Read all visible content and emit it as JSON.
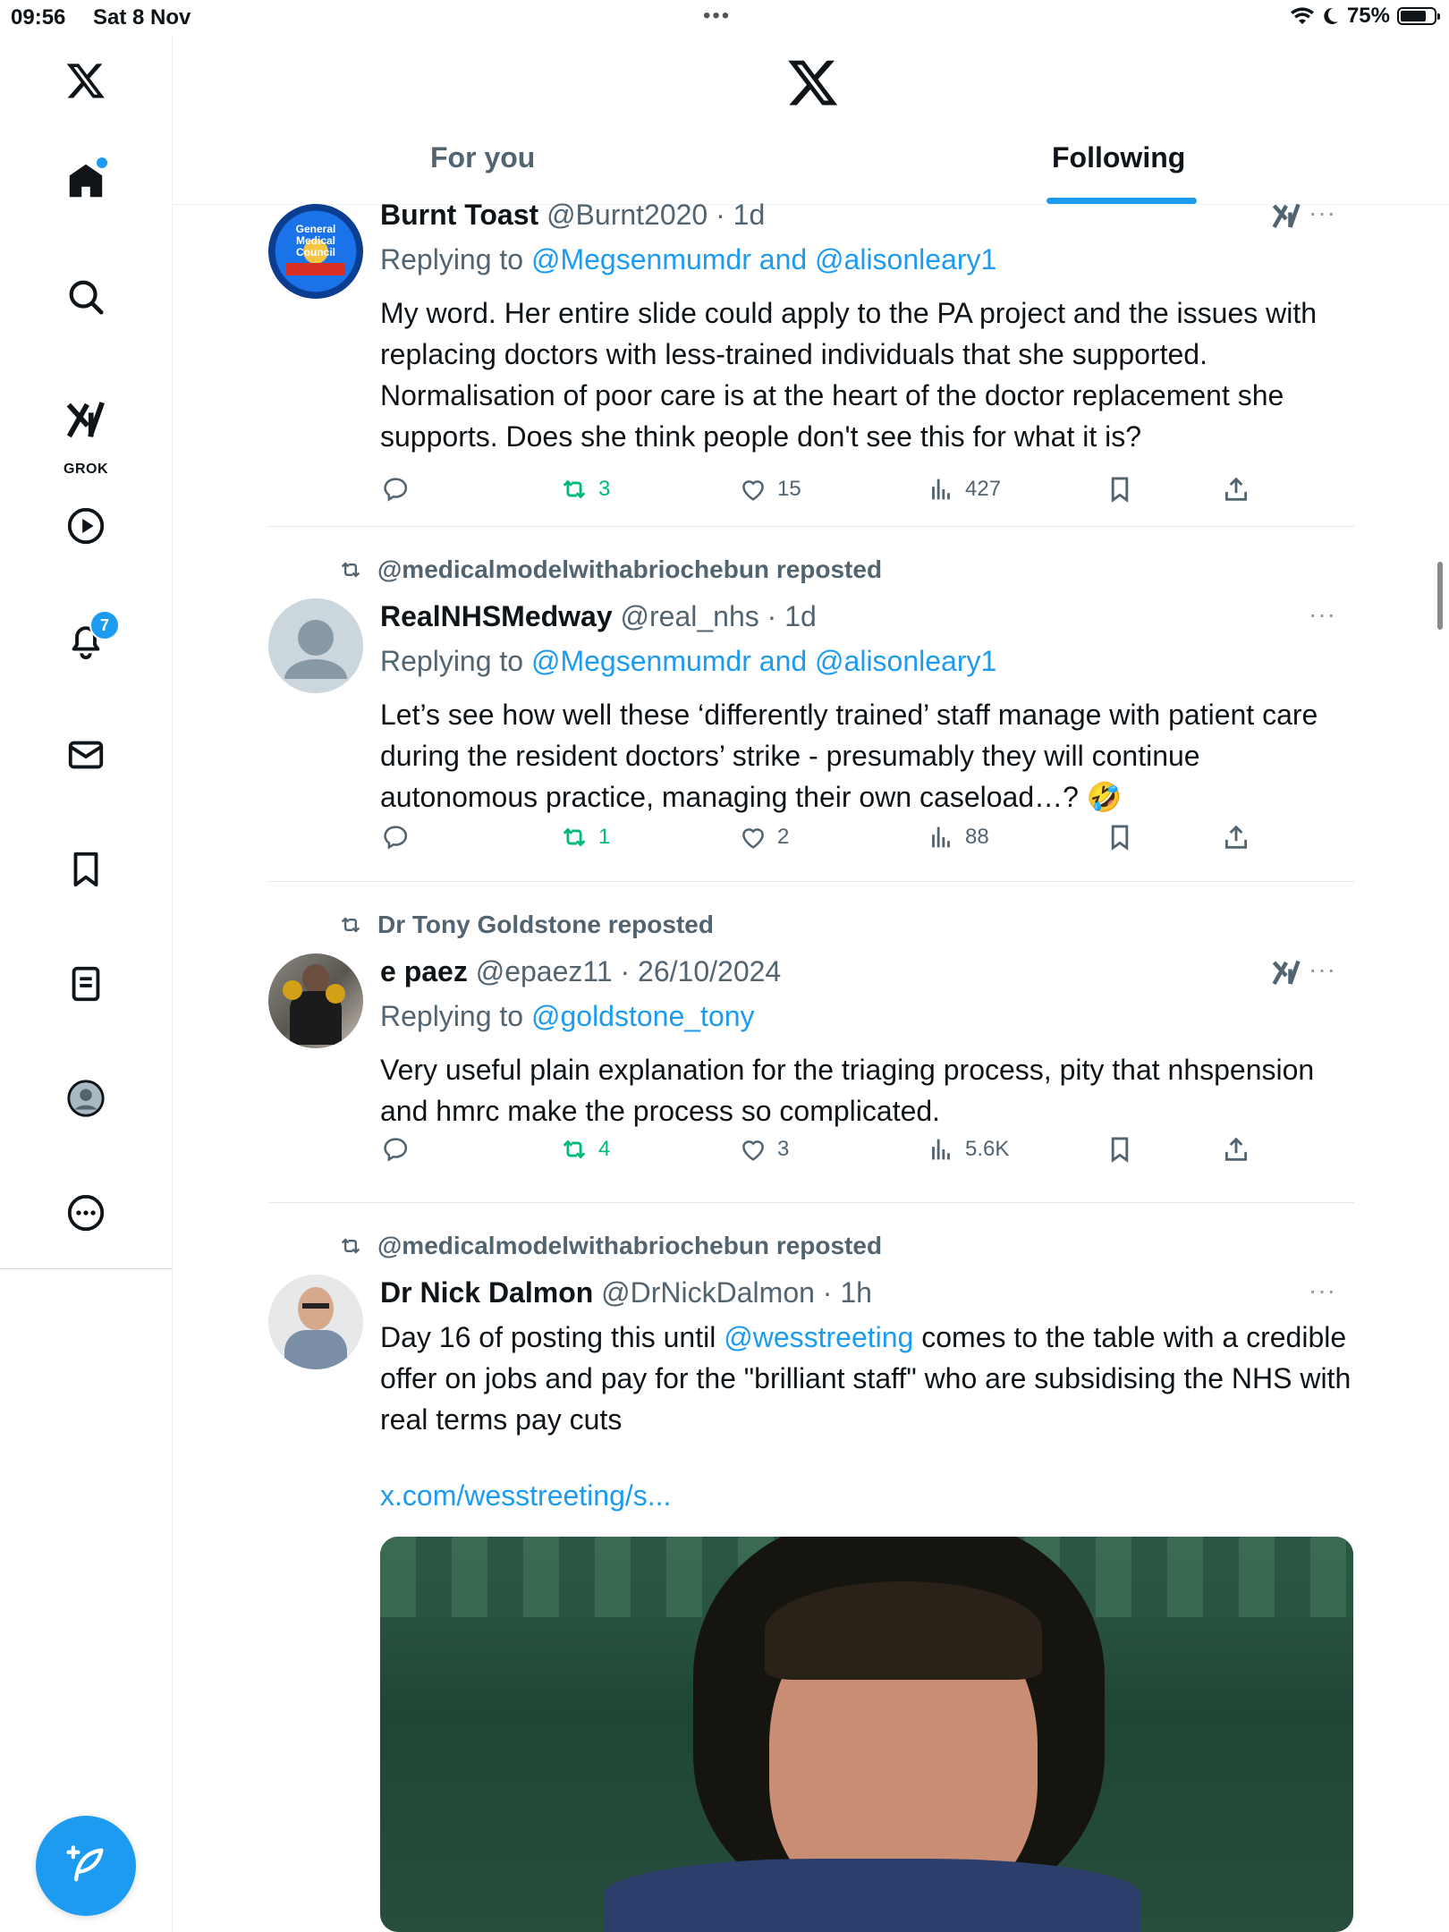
{
  "status_bar": {
    "time": "09:56",
    "date": "Sat 8 Nov",
    "battery": "75%",
    "battery_level": 0.75
  },
  "sidebar": {
    "logo": "x-logo-icon",
    "items": [
      {
        "name": "home",
        "icon": "home-icon",
        "has_dot": true
      },
      {
        "name": "search",
        "icon": "search-icon"
      },
      {
        "name": "grok",
        "icon": "grok-icon",
        "label": "GROK"
      },
      {
        "name": "videos",
        "icon": "play-icon"
      },
      {
        "name": "notifications",
        "icon": "bell-icon",
        "badge": "7"
      },
      {
        "name": "messages",
        "icon": "mail-icon"
      },
      {
        "name": "bookmarks",
        "icon": "bookmark-icon"
      },
      {
        "name": "lists",
        "icon": "list-icon"
      },
      {
        "name": "profile",
        "icon": "profile-icon"
      },
      {
        "name": "more",
        "icon": "more-circle-icon"
      }
    ],
    "compose_icon": "compose-icon"
  },
  "header": {
    "tabs": [
      {
        "label": "For you",
        "active": false
      },
      {
        "label": "Following",
        "active": true
      }
    ]
  },
  "colors": {
    "accent": "#1d9bf0",
    "repost_green": "#00ba7c",
    "muted": "#536471",
    "text": "#0f1419"
  },
  "posts": [
    {
      "repost_by": "",
      "name": "Burnt Toast",
      "handle": "@Burnt2020",
      "time": "· 1d",
      "replying_prefix": "Replying to ",
      "replying_to": "@Megsenmumdr and @alisonleary1",
      "text": "My word. Her entire slide could apply to the PA project and the issues with replacing doctors with less-trained individuals that she supported. Normalisation of poor care is at the heart of the doctor replacement she supports. Does she think people don't see this for what it is?",
      "reposts": "3",
      "likes": "15",
      "views": "427",
      "avatar_text": "General Medical Council"
    },
    {
      "repost_by": "@medicalmodelwithabriochebun reposted",
      "name": "RealNHSMedway",
      "handle": "@real_nhs",
      "time": "· 1d",
      "replying_prefix": "Replying to ",
      "replying_to": "@Megsenmumdr and @alisonleary1",
      "text": "Let’s see how well these ‘differently trained’ staff manage with patient care during the resident doctors’ strike - presumably they will continue autonomous practice, managing their own caseload…? 🤣",
      "reposts": "1",
      "likes": "2",
      "views": "88"
    },
    {
      "repost_by": "Dr Tony Goldstone reposted",
      "name": "e paez",
      "handle": "@epaez11",
      "time": "· 26/10/2024",
      "replying_prefix": "Replying to ",
      "replying_to": "@goldstone_tony",
      "text": "Very useful plain explanation for the triaging process, pity that nhspension and hmrc make the process so complicated.",
      "reposts": "4",
      "likes": "3",
      "views": "5.6K"
    },
    {
      "repost_by": "@medicalmodelwithabriochebun reposted",
      "name": "Dr Nick Dalmon",
      "handle": "@DrNickDalmon",
      "time": "· 1h",
      "text_before": "Day 16 of posting this until ",
      "mention": "@wesstreeting",
      "text_after": " comes to the table with a credible offer on jobs and pay for the \"brilliant staff\" who are subsidising the NHS with real terms pay cuts",
      "link": "x.com/wesstreeting/s..."
    }
  ]
}
